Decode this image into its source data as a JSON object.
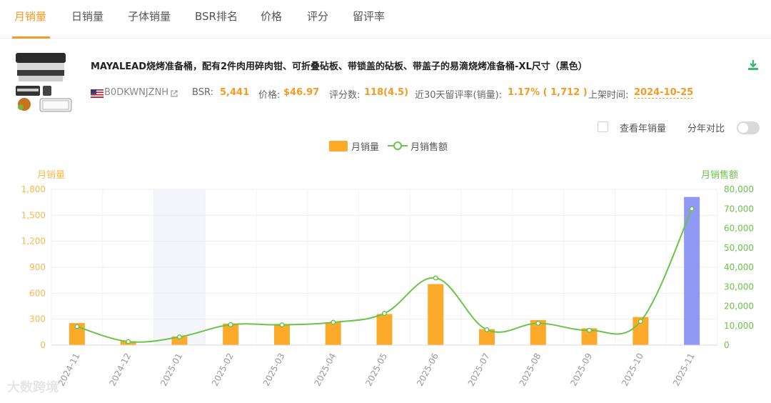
{
  "tabs": [
    {
      "label": "月销量",
      "active": true
    },
    {
      "label": "日销量",
      "active": false
    },
    {
      "label": "子体销量",
      "active": false
    },
    {
      "label": "BSR排名",
      "active": false
    },
    {
      "label": "价格",
      "active": false
    },
    {
      "label": "评分",
      "active": false
    },
    {
      "label": "留评率",
      "active": false
    }
  ],
  "product": {
    "title": "MAYALEAD烧烤准备桶，配有2件肉用碎肉钳、可折叠砧板、带锁盖的砧板、带盖子的易滴烧烤准备桶-XL尺寸（黑色）",
    "asin": "B0DKWNJZNH",
    "bsr_label": "BSR:",
    "bsr_value": "5,441",
    "price_label": "价格:",
    "price_value": "$46.97",
    "rating_label": "评分数:",
    "rating_value": "118(4.5)",
    "review_rate_label": "近30天留评率(销量):",
    "review_rate_value": "1.17% ( 1,712 )",
    "listed_label": "上架时间:",
    "listed_value": "2024-10-25"
  },
  "controls": {
    "yearly_checkbox_label": "查看年销量",
    "yearly_checked": false,
    "compare_label": "分年对比",
    "compare_on": false
  },
  "watermark": "大数跨境",
  "colors": {
    "accent": "#f59a23",
    "bar": "#fdaa2a",
    "bar_highlight": "#8f99f5",
    "line": "#6bc34a",
    "left_axis": "#f5b94a",
    "right_axis": "#6bc34a",
    "hover_band": "#f3f5fa"
  },
  "chart_data": {
    "type": "bar",
    "categories": [
      "2024-11",
      "2024-12",
      "2025-01",
      "2025-02",
      "2025-03",
      "2025-04",
      "2025-05",
      "2025-06",
      "2025-07",
      "2025-08",
      "2025-09",
      "2025-10",
      "2025-11"
    ],
    "series": [
      {
        "name": "月销量",
        "type": "bar",
        "axis": "left",
        "values": [
          255,
          45,
          100,
          250,
          245,
          265,
          360,
          705,
          185,
          290,
          195,
          325,
          1712
        ]
      },
      {
        "name": "月销售额",
        "type": "line",
        "axis": "right",
        "smooth": true,
        "values": [
          9500,
          1800,
          4200,
          10500,
          10400,
          11700,
          16300,
          34500,
          7900,
          11200,
          7600,
          12200,
          70000
        ]
      }
    ],
    "left_axis": {
      "title": "月销量",
      "min": 0,
      "max": 1800,
      "ticks": [
        "0",
        "300",
        "600",
        "900",
        "1,200",
        "1,500",
        "1,800"
      ]
    },
    "right_axis": {
      "title": "月销售额",
      "min": 0,
      "max": 80000,
      "ticks": [
        "0",
        "10,000",
        "20,000",
        "30,000",
        "40,000",
        "50,000",
        "60,000",
        "70,000",
        "80,000"
      ]
    },
    "highlighted_category": "2025-01",
    "highlighted_bar": "2025-11",
    "grid": true,
    "legend": "top-center"
  }
}
